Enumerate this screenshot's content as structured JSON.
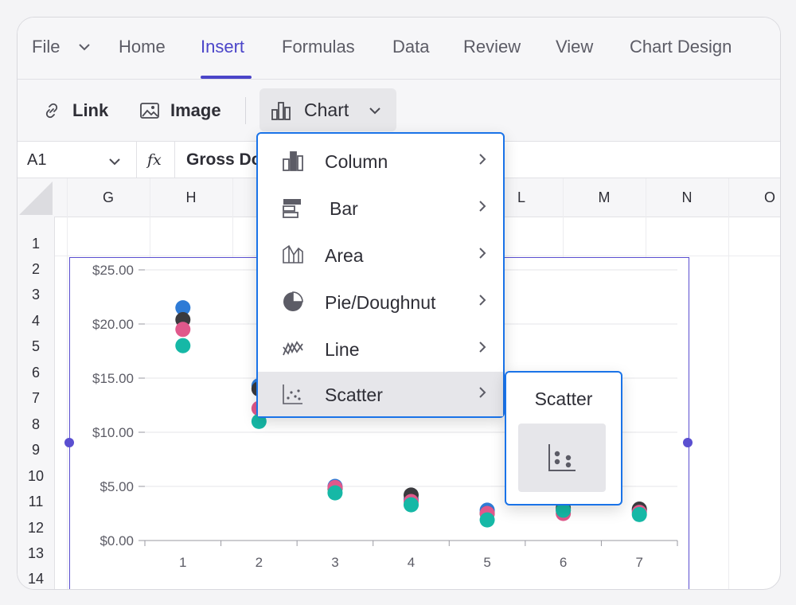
{
  "menubar": {
    "items": [
      "File",
      "Home",
      "Insert",
      "Formulas",
      "Data",
      "Review",
      "View",
      "Chart Design"
    ],
    "active": "Insert"
  },
  "ribbon": {
    "link": "Link",
    "image": "Image",
    "chart": "Chart"
  },
  "formula_bar": {
    "cell_ref": "A1",
    "fx": "fx",
    "value": "Gross Do"
  },
  "columns": [
    "G",
    "H",
    "L",
    "M",
    "N",
    "O"
  ],
  "rows": [
    "1",
    "2",
    "3",
    "4",
    "5",
    "6",
    "7",
    "8",
    "9",
    "10",
    "11",
    "12",
    "13",
    "14"
  ],
  "chart_dropdown": {
    "items": [
      "Column",
      "Bar",
      "Area",
      "Pie/Doughnut",
      "Line",
      "Scatter"
    ],
    "highlighted": "Scatter"
  },
  "scatter_submenu": {
    "title": "Scatter"
  },
  "colors": {
    "accent": "#4b45c9",
    "focus": "#1a73e8",
    "blue": "#2e7bd6",
    "dark": "#3a3a3e",
    "pink": "#e0588b",
    "teal": "#16b8a6"
  },
  "chart_data": {
    "type": "scatter",
    "x": [
      1,
      2,
      3,
      4,
      5,
      6,
      7
    ],
    "ylim": [
      0,
      25
    ],
    "y_ticks": [
      "$0.00",
      "$5.00",
      "$10.00",
      "$15.00",
      "$20.00",
      "$25.00"
    ],
    "x_ticks": [
      "1",
      "2",
      "3",
      "4",
      "5",
      "6",
      "7"
    ],
    "series": [
      {
        "color": "#2e7bd6",
        "values": [
          21.5,
          14.3,
          5.0,
          3.8,
          2.8,
          2.8,
          2.8
        ]
      },
      {
        "color": "#3a3a3e",
        "values": [
          20.4,
          14.0,
          4.8,
          4.2,
          2.5,
          3.0,
          2.9
        ]
      },
      {
        "color": "#e0588b",
        "values": [
          19.5,
          12.2,
          4.9,
          3.6,
          2.5,
          2.5,
          2.6
        ]
      },
      {
        "color": "#16b8a6",
        "values": [
          18.0,
          11.0,
          4.4,
          3.3,
          1.9,
          2.8,
          2.4
        ]
      }
    ]
  }
}
